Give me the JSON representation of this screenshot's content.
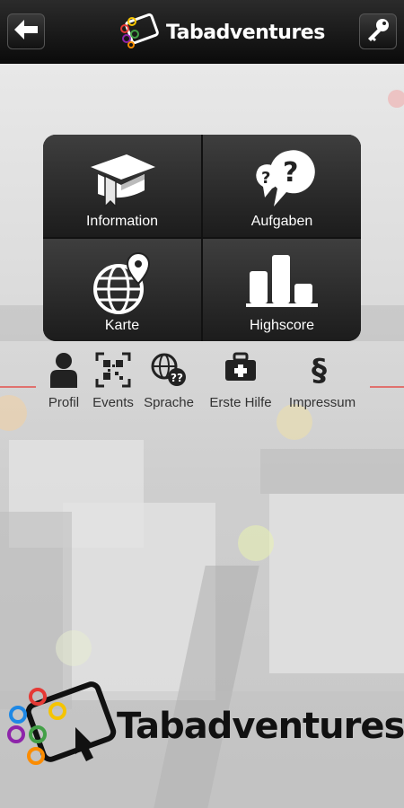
{
  "header": {
    "app_name": "Tabadventures",
    "back_icon": "back-arrow-icon",
    "login_icon": "key-icon"
  },
  "tiles": [
    {
      "label": "Information",
      "icon": "book-icon"
    },
    {
      "label": "Aufgaben",
      "icon": "question-bubble-icon"
    },
    {
      "label": "Karte",
      "icon": "globe-pin-icon"
    },
    {
      "label": "Highscore",
      "icon": "bar-chart-icon"
    }
  ],
  "links": [
    {
      "label": "Profil",
      "icon": "person-icon"
    },
    {
      "label": "Events",
      "icon": "qr-code-icon"
    },
    {
      "label": "Sprache",
      "icon": "globe-language-icon"
    },
    {
      "label": "Erste Hilfe",
      "icon": "first-aid-kit-icon"
    },
    {
      "label": "Impressum",
      "icon": "paragraph-icon"
    }
  ],
  "footer": {
    "brand": "Tabadventures"
  },
  "colors": {
    "topbar": "#111111",
    "tile": "#2b2b2b",
    "accent_red": "#e0716e",
    "logo_ring_red": "#e53935",
    "logo_ring_yellow": "#f5c400",
    "logo_ring_green": "#43a047",
    "logo_ring_blue": "#1e88e5",
    "logo_ring_purple": "#8e24aa",
    "logo_ring_orange": "#fb8c00"
  }
}
